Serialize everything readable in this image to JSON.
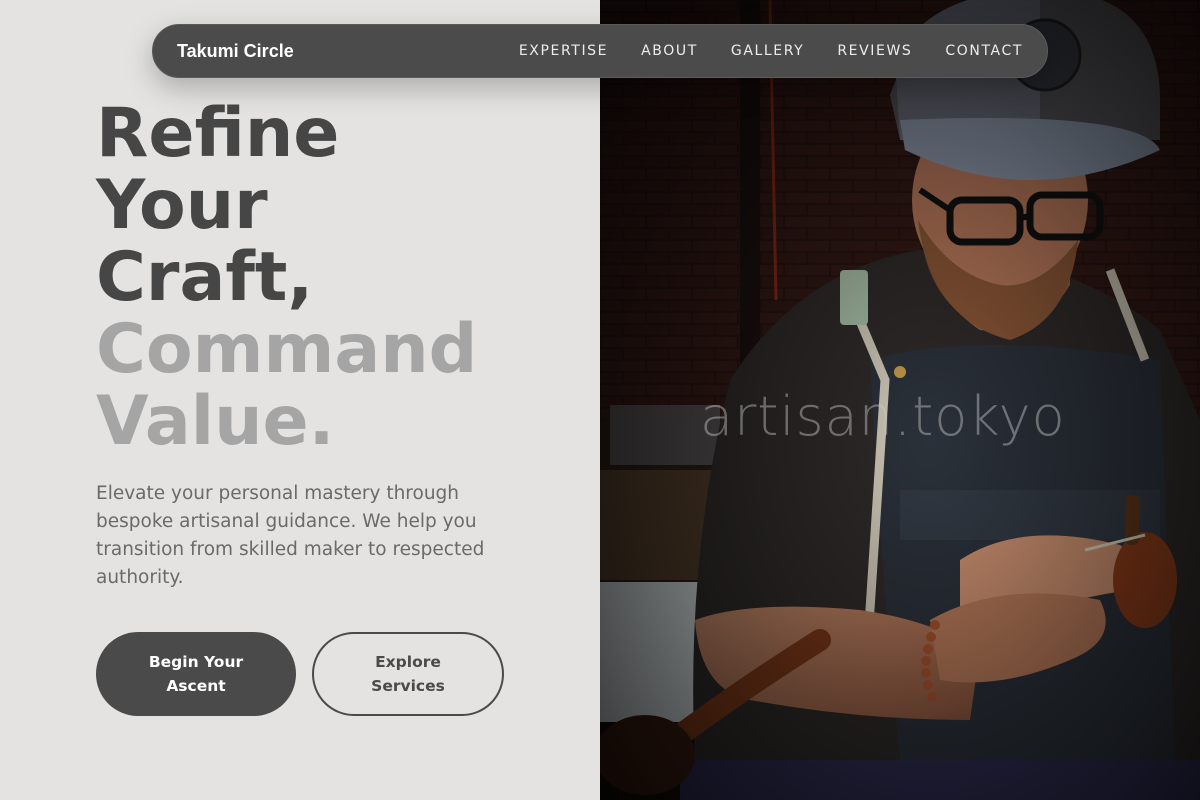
{
  "nav": {
    "brand": "Takumi Circle",
    "links": [
      "EXPERTISE",
      "ABOUT",
      "GALLERY",
      "REVIEWS",
      "CONTACT"
    ]
  },
  "hero": {
    "headline_lines": [
      "Refine",
      "Your",
      "Craft,"
    ],
    "headline_accent_lines": [
      "Command",
      "Value."
    ],
    "subtitle": "Elevate your personal mastery through bespoke artisanal guidance. We help you transition from skilled maker to respected authority.",
    "primary_button": "Begin Your Ascent",
    "secondary_button": "Explore Services"
  },
  "photo": {
    "watermark": "artisan.tokyo",
    "subject": "craftsman in cap and apron carving wood"
  },
  "colors": {
    "background": "#e4e3e1",
    "dark_text": "#464646",
    "accent_text": "#a5a5a5",
    "navbar": "#4b4b4b",
    "button_dark": "#4a4a4a"
  }
}
